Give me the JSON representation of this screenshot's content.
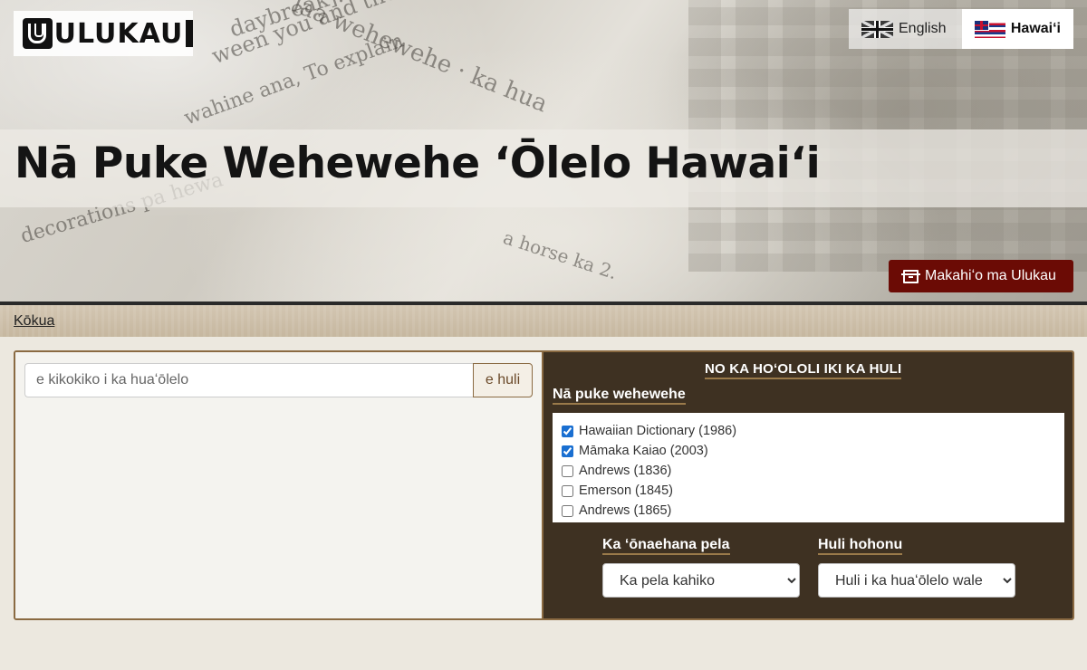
{
  "header": {
    "logo_text": "ULUKAU",
    "title": "Nā Puke Wehewehe ʻŌlelo Hawaiʻi",
    "languages": [
      {
        "label": "English",
        "icon": "uk-flag-icon",
        "active": false
      },
      {
        "label": "Hawaiʻi",
        "icon": "hawaii-flag-icon",
        "active": true
      }
    ],
    "archive_button": "Makahiʻo ma Ulukau"
  },
  "nav": {
    "help_link": "Kōkua"
  },
  "search": {
    "placeholder": "e kikokiko i ka huaʻōlelo",
    "button_label": "e huli"
  },
  "options": {
    "heading": "NO KA HOʻOLOLI IKI KA HULI",
    "dictionaries_heading": "Nā puke wehewehe",
    "dictionaries": [
      {
        "label": "Hawaiian Dictionary (1986)",
        "checked": true
      },
      {
        "label": "Māmaka Kaiao (2003)",
        "checked": true
      },
      {
        "label": "Andrews (1836)",
        "checked": false
      },
      {
        "label": "Emerson (1845)",
        "checked": false
      },
      {
        "label": "Andrews (1865)",
        "checked": false
      }
    ],
    "spelling_label": "Ka ʻōnaehana pela",
    "spelling_selected": "Ka pela kahiko",
    "depth_label": "Huli hohonu",
    "depth_selected": "Huli i ka huaʻōlelo wale nō"
  },
  "colors": {
    "archive_button_bg": "#6b0b05",
    "options_panel_bg": "#3e3122",
    "panel_border": "#8a6a42",
    "page_bg": "#ece8df"
  }
}
